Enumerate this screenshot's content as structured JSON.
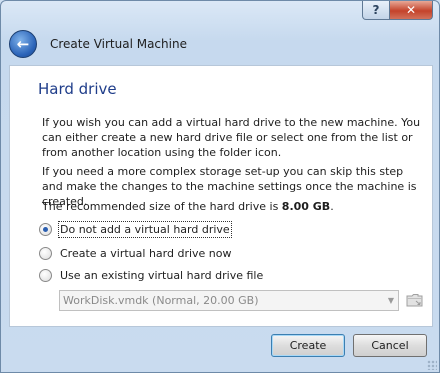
{
  "window": {
    "title": "Create Virtual Machine",
    "help_glyph": "?",
    "close_glyph": "✕"
  },
  "page": {
    "title": "Hard drive",
    "paragraph1": "If you wish you can add a virtual hard drive to the new machine. You can either create a new hard drive file or select one from the list or from another location using the folder icon.",
    "paragraph2": "If you need a more complex storage set-up you can skip this step and make the changes to the machine settings once the machine is created.",
    "recommended_prefix": "The recommended size of the hard drive is ",
    "recommended_size": "8.00 GB",
    "recommended_suffix": "."
  },
  "options": [
    {
      "label": "Do not add a virtual hard drive",
      "selected": true
    },
    {
      "label": "Create a virtual hard drive now",
      "selected": false
    },
    {
      "label": "Use an existing virtual hard drive file",
      "selected": false
    }
  ],
  "existing_disk": {
    "value": "WorkDisk.vmdk (Normal, 20.00 GB)",
    "enabled": false
  },
  "buttons": {
    "create": "Create",
    "cancel": "Cancel"
  },
  "icons": {
    "back": "back-arrow-icon",
    "folder": "folder-icon",
    "dropdown": "chevron-down-icon"
  }
}
